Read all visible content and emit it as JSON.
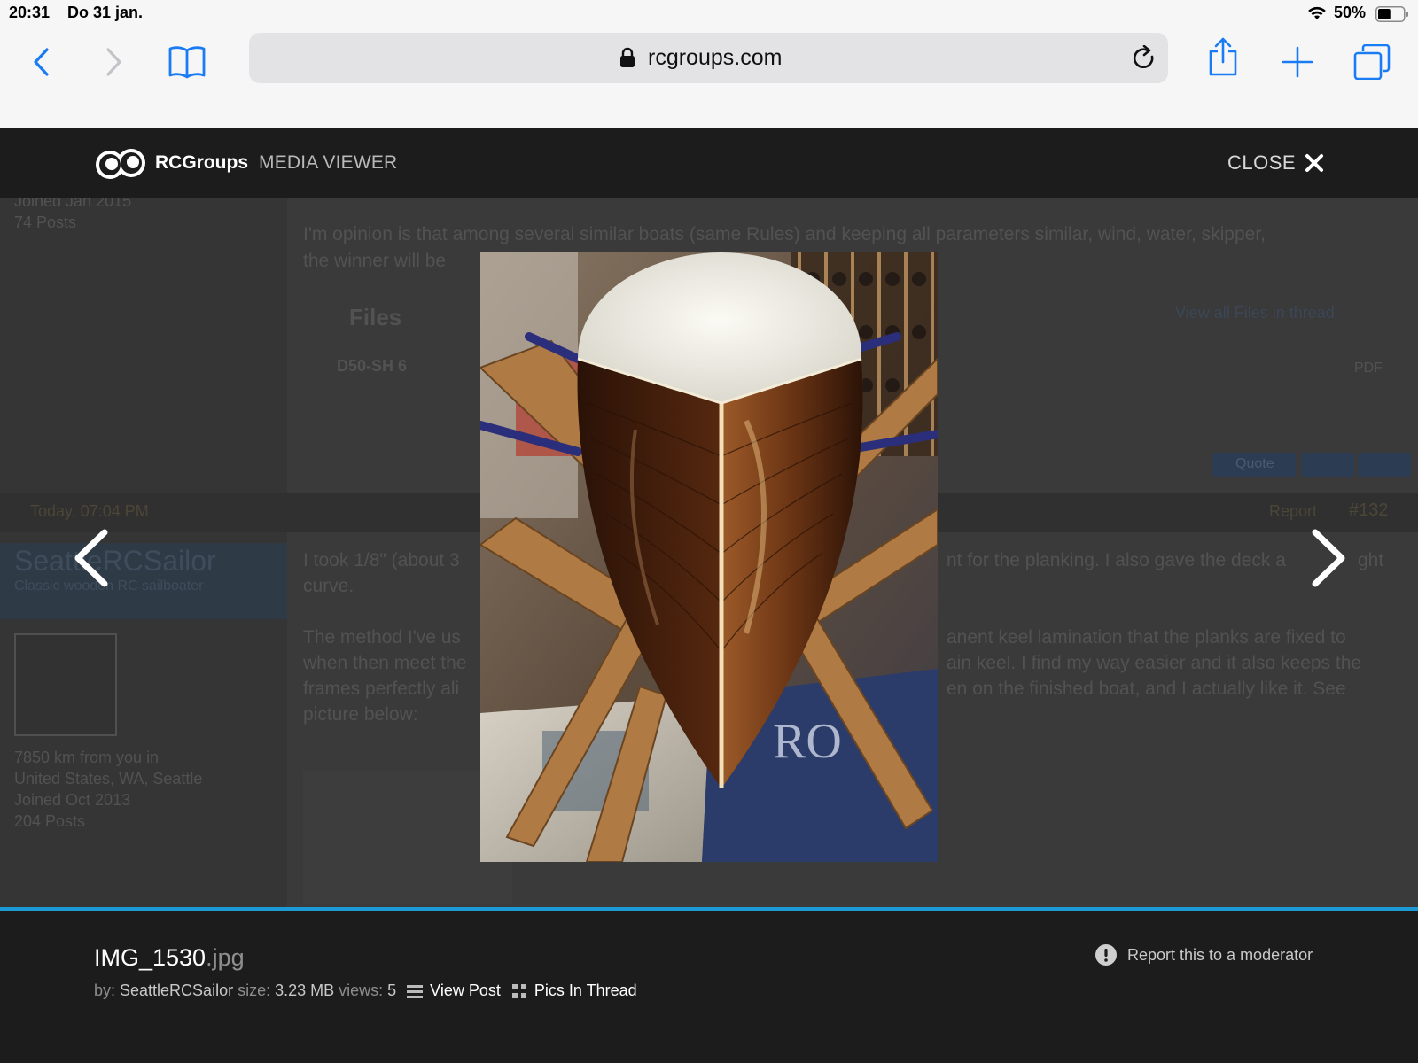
{
  "status_bar": {
    "time": "20:31",
    "date": "Do 31 jan.",
    "battery_percent": "50%",
    "battery_level": 0.5
  },
  "browser": {
    "url": "rcgroups.com",
    "icons": [
      "back-icon",
      "forward-icon",
      "bookmarks-icon",
      "lock-icon",
      "reload-icon",
      "share-icon",
      "new-tab-icon",
      "tabs-icon"
    ]
  },
  "background_page": {
    "user1_joined": "Joined Jan 2015",
    "user1_posts": "74 Posts",
    "post1_text": "I'm opinion is that among several similar boats (same Rules) and keeping all parameters similar, wind, water, skipper,",
    "post1_text2": "the winner will be",
    "files_heading": "Files",
    "files_link": "View all Files in thread",
    "file_item": "D50-SH 6",
    "file_type": "PDF",
    "quote_button": "Quote",
    "post2_date": "Today, 07:04 PM",
    "report_label": "Report",
    "post_number": "#132",
    "username": "SeattleRCSailor",
    "user_title": "Classic wooden RC sailboater",
    "distance": "7850 km from you in",
    "location": "United States, WA, Seattle",
    "user2_joined": "Joined Oct 2013",
    "user2_posts": "204 Posts",
    "post2_line1a": "I took 1/8\" (about 3",
    "post2_line1b": "nt for the planking. I also gave the deck a",
    "post2_line1c": "ght",
    "post2_line2": "curve.",
    "post2_line3a": "The method I've us",
    "post2_line3b": "anent keel lamination that the planks are fixed to",
    "post2_line4a": "when then meet the",
    "post2_line4b": "ain keel. I find my way easier and it also keeps the",
    "post2_line5a": "frames perfectly ali",
    "post2_line5b": "en on the finished boat, and I actually like it. See",
    "post2_line6": "picture below:"
  },
  "viewer": {
    "brand_name": "RCGroups",
    "brand_sub": "MEDIA VIEWER",
    "close_label": "CLOSE",
    "icons": [
      "rcgroups-logo-icon",
      "close-icon",
      "chevron-left-icon",
      "chevron-right-icon"
    ]
  },
  "file": {
    "name": "IMG_1530",
    "ext": ".jpg",
    "by_label": "by:",
    "author": "SeattleRCSailor",
    "size_label": "size:",
    "size": "3.23 MB",
    "views_label": "views:",
    "views": "5",
    "view_post": "View Post",
    "pics_in_thread": "Pics In Thread",
    "report": "Report this to a moderator"
  },
  "colors": {
    "accent_blue": "#1b9ad6",
    "ios_blue": "#1a7cf5",
    "viewer_bg": "#1c1c1c"
  }
}
